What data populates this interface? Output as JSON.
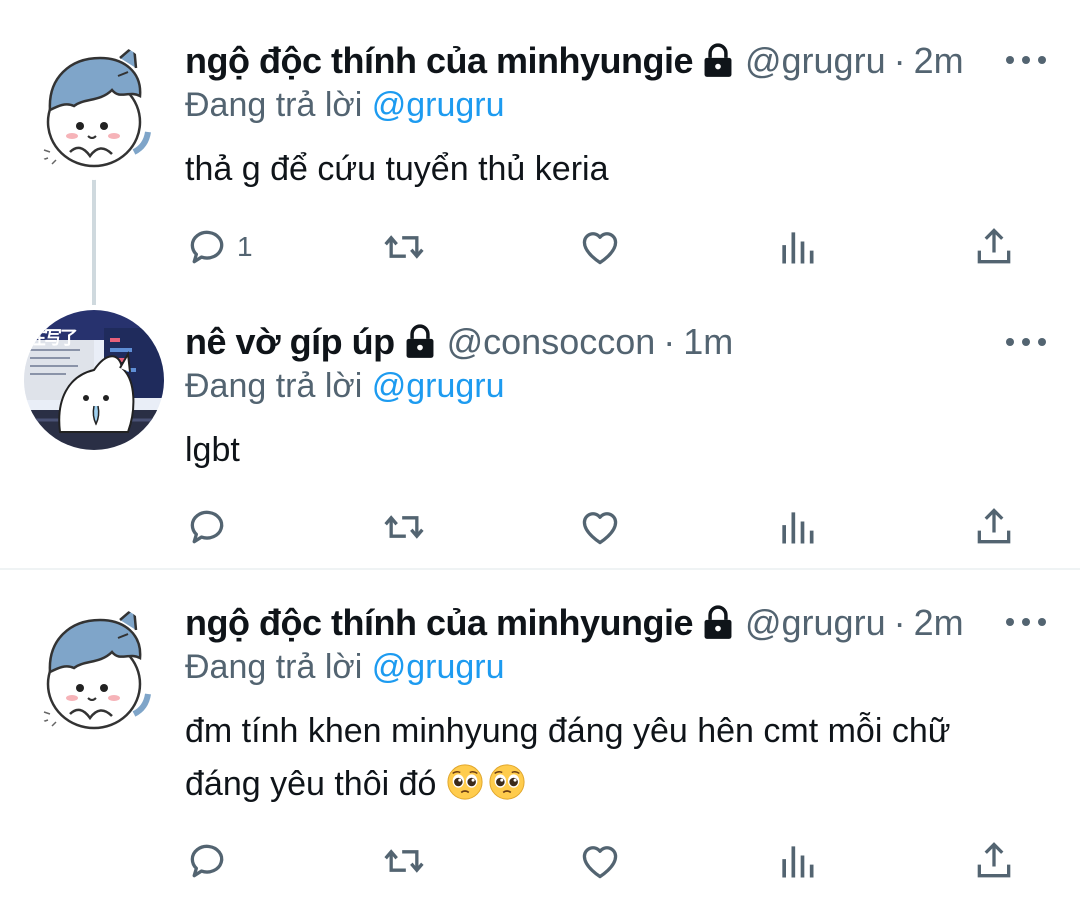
{
  "tweets": [
    {
      "display_name": "ngộ độc thính của minhyungie",
      "handle": "@grugru",
      "separator": "·",
      "time": "2m",
      "reply_prefix": "Đang trả lời",
      "reply_to": "@grugru",
      "text_lines": [
        "thả g để cứu tuyển thủ keria"
      ],
      "reply_count": "1",
      "avatar": "blue-hat-cat-avatar"
    },
    {
      "display_name": "nê vờ gíp úp",
      "handle": "@consoccon",
      "separator": "·",
      "time": "1m",
      "reply_prefix": "Đang trả lời",
      "reply_to": "@grugru",
      "text_lines": [
        "lgbt"
      ],
      "reply_count": "",
      "avatar": "white-cat-desk-avatar",
      "avatar_chinese_text": "在写了"
    },
    {
      "display_name": "ngộ độc thính của minhyungie",
      "handle": "@grugru",
      "separator": "·",
      "time": "2m",
      "reply_prefix": "Đang trả lời",
      "reply_to": "@grugru",
      "text_lines": [
        "đm tính khen minhyung đáng yêu hên cmt mỗi chữ",
        "đáng yêu thôi đó"
      ],
      "emoji": [
        "pleading-face-emoji",
        "pleading-face-emoji"
      ],
      "reply_count": "",
      "avatar": "blue-hat-cat-avatar"
    }
  ],
  "icons": {
    "lock": "lock-icon",
    "reply": "reply-icon",
    "retweet": "retweet-icon",
    "like": "like-icon",
    "views": "views-icon",
    "share": "share-icon",
    "more": "more-icon"
  },
  "colors": {
    "text": "#0f1419",
    "secondary": "#536471",
    "link": "#1d9bf0",
    "thread_line": "#cfd9de",
    "divider": "#eff3f4",
    "avatar_hat": "#7fa5c9"
  }
}
